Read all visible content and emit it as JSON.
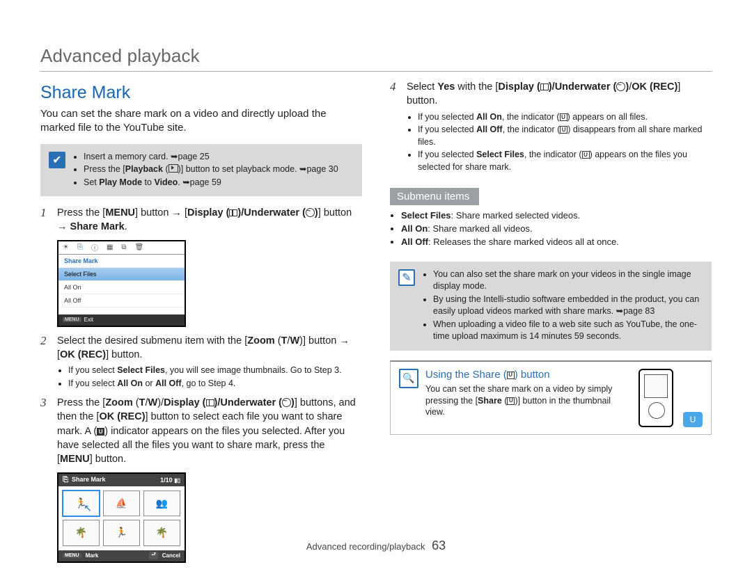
{
  "breadcrumb": "Advanced playback",
  "section_title": "Share Mark",
  "intro": "You can set the share mark on a video and directly upload the marked file to the YouTube site.",
  "prep_box": {
    "items": [
      "Insert a memory card. ➥page 25",
      "Press the [Playback (▣)] button to set playback mode. ➥page 30",
      "Set Play Mode to Video. ➥page 59"
    ]
  },
  "steps_left": [
    {
      "num": "1",
      "body_parts": [
        "Press the [",
        "MENU",
        "] button → [",
        "Display (",
        ")/Underwater (",
        ")",
        "] button → ",
        "Share Mark",
        "."
      ]
    },
    {
      "num": "2",
      "body_parts": [
        "Select the desired submenu item with the [",
        "Zoom (T/W)",
        "] button → [",
        "OK (REC)",
        "] button."
      ],
      "sub": [
        "If you select Select Files, you will see image thumbnails. Go to Step 3.",
        "If you select All On or All Off, go to Step 4."
      ]
    },
    {
      "num": "3",
      "body_parts": [
        "Press the [",
        "Zoom (T/W)",
        "/",
        "Display (",
        ")/Underwater (",
        ")",
        "] buttons, and then the [",
        "OK (REC)",
        "] button to select each file you want to share mark. A (",
        ") indicator appears on the files you selected. After you have selected all the files you want to share mark, press the [",
        "MENU",
        "] button."
      ]
    }
  ],
  "shot1": {
    "title": "Share Mark",
    "rows": [
      "Select Files",
      "All On",
      "All Off"
    ],
    "footer": "Exit"
  },
  "shot2": {
    "title": "Share Mark",
    "count": "1/10",
    "footer_left": "Mark",
    "footer_right": "Cancel"
  },
  "steps_right": [
    {
      "num": "4",
      "body_parts": [
        "Select ",
        "Yes",
        " with the [",
        "Display (",
        ")/Underwater (",
        ")",
        "/",
        "OK (REC)",
        "] button."
      ],
      "sub": [
        "If you selected All On, the indicator (🅄) appears on all files.",
        "If you selected All Off, the indicator (🅄) disappears from all share marked files.",
        "If you selected Select Files, the indicator (🅄) appears on the files you selected for share mark."
      ]
    }
  ],
  "submenu_header": "Submenu items",
  "submenu_items": [
    {
      "label": "Select Files",
      "desc": ": Share marked selected videos."
    },
    {
      "label": "All On",
      "desc": ": Share marked all videos."
    },
    {
      "label": "All Off",
      "desc": ": Releases the share marked videos all at once."
    }
  ],
  "note2": [
    "You can also set the share mark on your videos in the single image display mode.",
    "By using the Intelli-studio software embedded in the product, you can easily upload videos marked with share marks. ➥page 83",
    "When uploading a video file to a web site such as YouTube, the one-time upload maximum is 14 minutes 59 seconds."
  ],
  "tip": {
    "title": "Using the Share (🅄) button",
    "body": "You can set the share mark on a video by simply pressing the [Share (🅄)] button in the thumbnail view."
  },
  "footer": {
    "text": "Advanced recording/playback",
    "page": "63"
  }
}
